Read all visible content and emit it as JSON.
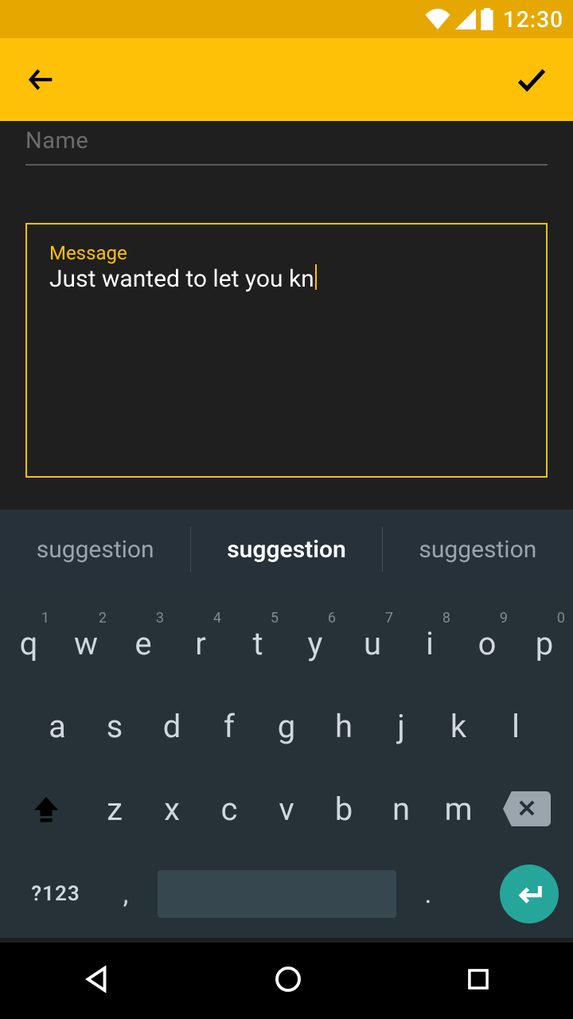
{
  "status": {
    "time": "12:30"
  },
  "form": {
    "name_placeholder": "Name",
    "name_value": "",
    "message_label": "Message",
    "message_value": "Just wanted to let you kn"
  },
  "suggestions": [
    "suggestion",
    "suggestion",
    "suggestion"
  ],
  "keyboard": {
    "row1": [
      {
        "k": "q",
        "n": "1"
      },
      {
        "k": "w",
        "n": "2"
      },
      {
        "k": "e",
        "n": "3"
      },
      {
        "k": "r",
        "n": "4"
      },
      {
        "k": "t",
        "n": "5"
      },
      {
        "k": "y",
        "n": "6"
      },
      {
        "k": "u",
        "n": "7"
      },
      {
        "k": "i",
        "n": "8"
      },
      {
        "k": "o",
        "n": "9"
      },
      {
        "k": "p",
        "n": "0"
      }
    ],
    "row2": [
      "a",
      "s",
      "d",
      "f",
      "g",
      "h",
      "j",
      "k",
      "l"
    ],
    "row3": [
      "z",
      "x",
      "c",
      "v",
      "b",
      "n",
      "m"
    ],
    "symbols_label": "?123",
    "comma": ",",
    "period": "."
  }
}
